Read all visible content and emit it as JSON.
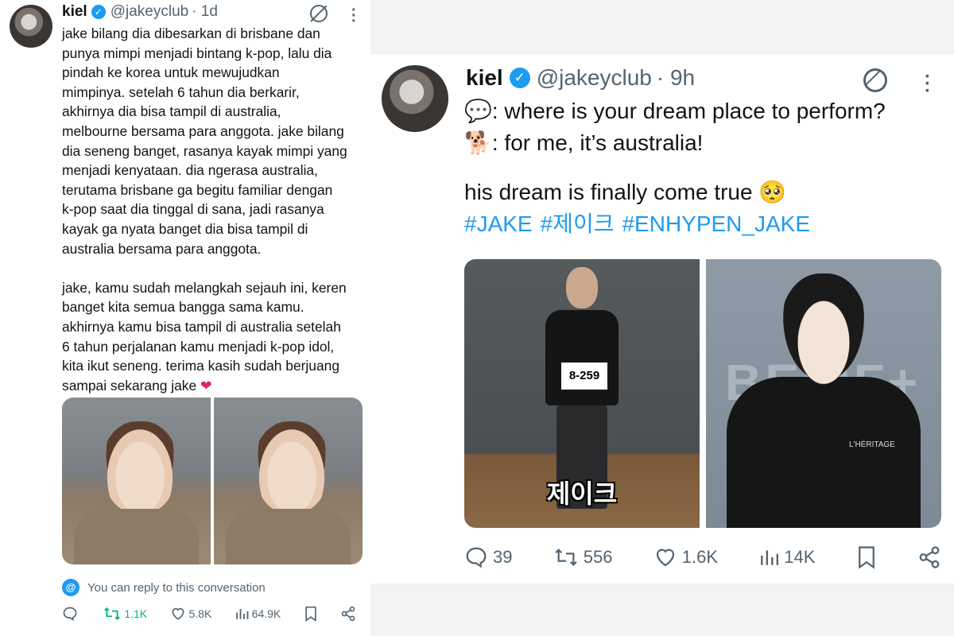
{
  "left_tweet": {
    "author": {
      "name": "kiel",
      "handle": "@jakeyclub",
      "time": "· 1d"
    },
    "paragraph_1": "jake bilang dia dibesarkan di brisbane dan\npunya mimpi menjadi bintang k-pop, lalu dia\npindah ke korea untuk mewujudkan\nmimpinya. setelah 6 tahun dia berkarir,\nakhirnya dia bisa tampil di australia,\nmelbourne bersama para anggota. jake bilang\ndia seneng banget, rasanya kayak mimpi yang\nmenjadi kenyataan. dia ngerasa australia,\nterutama brisbane ga begitu familiar dengan\nk-pop saat dia tinggal di sana, jadi rasanya\nkayak ga nyata banget dia bisa tampil di\naustralia bersama para anggota.",
    "paragraph_2": "jake, kamu sudah melangkah sejauh ini, keren\nbanget kita semua bangga sama kamu.\nakhirnya kamu bisa tampil di australia setelah\n6 tahun perjalanan kamu menjadi k-pop idol,\nkita ikut seneng. terima kasih sudah berjuang\nsampai sekarang jake",
    "heart_emoji": "❤",
    "reply_note": "You can reply to this conversation",
    "stats": {
      "replies": "",
      "reposts": "1.1K",
      "likes": "5.8K",
      "views": "64.9K"
    }
  },
  "right_tweet": {
    "author": {
      "name": "kiel",
      "handle": "@jakeyclub",
      "time": "· 9h"
    },
    "line_1_emoji": "💬",
    "line_1": ": where is your dream place to perform?",
    "line_2_emoji": "🐕",
    "line_2": ": for me, it’s australia!",
    "line_3": "his dream is finally come true 🥺",
    "hashtags": [
      "#JAKE",
      "#제이크",
      "#ENHYPEN_JAKE"
    ],
    "photo_1": {
      "tag": "8-259",
      "caption": "제이크"
    },
    "photo_2": {
      "background_text": "BELIF+",
      "shirt_logo": "L'HÉRITAGE"
    },
    "stats": {
      "replies": "39",
      "reposts": "556",
      "likes": "1.6K",
      "views": "14K"
    }
  },
  "colors": {
    "accent": "#1d9bf0",
    "muted": "#536471",
    "repost_active": "#00ba7c",
    "heart": "#e0245e"
  }
}
